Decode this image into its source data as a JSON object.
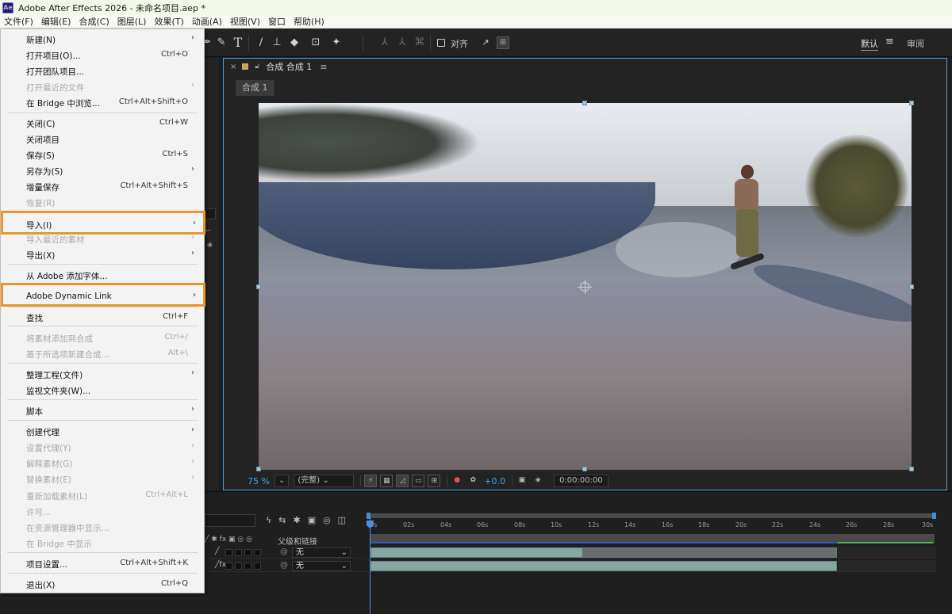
{
  "window": {
    "app_icon": "Ae",
    "title": "Adobe After Effects 2026 - 未命名项目.aep *"
  },
  "menubar": [
    "文件(F)",
    "编辑(E)",
    "合成(C)",
    "图层(L)",
    "效果(T)",
    "动画(A)",
    "视图(V)",
    "窗口",
    "帮助(H)"
  ],
  "toolbar": {
    "snap_label": "对齐",
    "workspace_default": "默认",
    "workspace_menu": "≡",
    "workspace_learn": "审阅"
  },
  "composition": {
    "tab_label": "合成 合成 1",
    "breadcrumb": "合成 1",
    "zoom": "75 %",
    "resolution": "(完整)",
    "exposure": "+0.0",
    "timecode": "0:00:00:00"
  },
  "timeline": {
    "parent_header": "父级和链接",
    "ruler": [
      "0s",
      "02s",
      "04s",
      "06s",
      "08s",
      "10s",
      "12s",
      "14s",
      "16s",
      "18s",
      "20s",
      "22s",
      "24s",
      "26s",
      "28s",
      "30s"
    ],
    "layers": [
      {
        "parent": "无"
      },
      {
        "parent": "无"
      }
    ]
  },
  "file_menu": {
    "items": [
      {
        "label": "新建(N)",
        "shortcut": "",
        "submenu": true,
        "disabled": false
      },
      {
        "label": "打开项目(O)...",
        "shortcut": "Ctrl+O",
        "submenu": false,
        "disabled": false
      },
      {
        "label": "打开团队项目...",
        "shortcut": "",
        "submenu": false,
        "disabled": false
      },
      {
        "label": "打开最近的文件",
        "shortcut": "",
        "submenu": true,
        "disabled": true
      },
      {
        "label": "在 Bridge 中浏览...",
        "shortcut": "Ctrl+Alt+Shift+O",
        "submenu": false,
        "disabled": false
      },
      {
        "label": "关闭(C)",
        "shortcut": "Ctrl+W",
        "submenu": false,
        "disabled": false
      },
      {
        "label": "关闭项目",
        "shortcut": "",
        "submenu": false,
        "disabled": false
      },
      {
        "label": "保存(S)",
        "shortcut": "Ctrl+S",
        "submenu": false,
        "disabled": false
      },
      {
        "label": "另存为(S)",
        "shortcut": "",
        "submenu": true,
        "disabled": false
      },
      {
        "label": "增量保存",
        "shortcut": "Ctrl+Alt+Shift+S",
        "submenu": false,
        "disabled": false
      },
      {
        "label": "恢复(R)",
        "shortcut": "",
        "submenu": false,
        "disabled": true
      },
      {
        "label": "导入(I)",
        "shortcut": "",
        "submenu": true,
        "disabled": false,
        "highlight": true
      },
      {
        "label": "导入最近的素材",
        "shortcut": "",
        "submenu": true,
        "disabled": true
      },
      {
        "label": "导出(X)",
        "shortcut": "",
        "submenu": true,
        "disabled": false
      },
      {
        "label": "从 Adobe 添加字体...",
        "shortcut": "",
        "submenu": false,
        "disabled": false
      },
      {
        "label": "Adobe Dynamic Link",
        "shortcut": "",
        "submenu": true,
        "disabled": false,
        "highlight": true
      },
      {
        "label": "查找",
        "shortcut": "Ctrl+F",
        "submenu": false,
        "disabled": false
      },
      {
        "label": "将素材添加到合成",
        "shortcut": "Ctrl+/",
        "submenu": false,
        "disabled": true
      },
      {
        "label": "基于所选项新建合成...",
        "shortcut": "Alt+\\",
        "submenu": false,
        "disabled": true
      },
      {
        "label": "整理工程(文件)",
        "shortcut": "",
        "submenu": true,
        "disabled": false
      },
      {
        "label": "监视文件夹(W)...",
        "shortcut": "",
        "submenu": false,
        "disabled": false
      },
      {
        "label": "脚本",
        "shortcut": "",
        "submenu": true,
        "disabled": false
      },
      {
        "label": "创建代理",
        "shortcut": "",
        "submenu": true,
        "disabled": false
      },
      {
        "label": "设置代理(Y)",
        "shortcut": "",
        "submenu": true,
        "disabled": true
      },
      {
        "label": "解释素材(G)",
        "shortcut": "",
        "submenu": true,
        "disabled": true
      },
      {
        "label": "替换素材(E)",
        "shortcut": "",
        "submenu": true,
        "disabled": true
      },
      {
        "label": "重新加载素材(L)",
        "shortcut": "Ctrl+Alt+L",
        "submenu": false,
        "disabled": true
      },
      {
        "label": "许可...",
        "shortcut": "",
        "submenu": false,
        "disabled": true
      },
      {
        "label": "在资源管理器中显示...",
        "shortcut": "",
        "submenu": false,
        "disabled": true
      },
      {
        "label": "在 Bridge 中显示",
        "shortcut": "",
        "submenu": false,
        "disabled": true
      },
      {
        "label": "项目设置...",
        "shortcut": "Ctrl+Alt+Shift+K",
        "submenu": false,
        "disabled": false
      },
      {
        "label": "退出(X)",
        "shortcut": "Ctrl+Q",
        "submenu": false,
        "disabled": false
      }
    ]
  }
}
